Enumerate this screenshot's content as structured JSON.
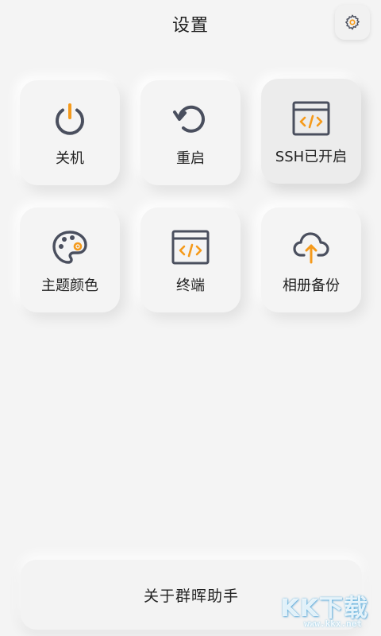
{
  "header": {
    "title": "设置",
    "settings_icon": "gear-icon"
  },
  "tiles": [
    {
      "label": "关机",
      "icon": "power-icon",
      "active": false
    },
    {
      "label": "重启",
      "icon": "restart-icon",
      "active": false
    },
    {
      "label": "SSH已开启",
      "icon": "code-window-icon",
      "active": true
    },
    {
      "label": "主题颜色",
      "icon": "palette-icon",
      "active": false
    },
    {
      "label": "终端",
      "icon": "terminal-window-icon",
      "active": false
    },
    {
      "label": "相册备份",
      "icon": "cloud-upload-icon",
      "active": false
    }
  ],
  "footer": {
    "about_label": "关于群晖助手"
  },
  "watermark": {
    "text": "KK下载",
    "url": "www.kkx.net"
  },
  "colors": {
    "accent": "#f59a1b",
    "icon_dark": "#4a4f5e",
    "background": "#f4f4f4"
  }
}
